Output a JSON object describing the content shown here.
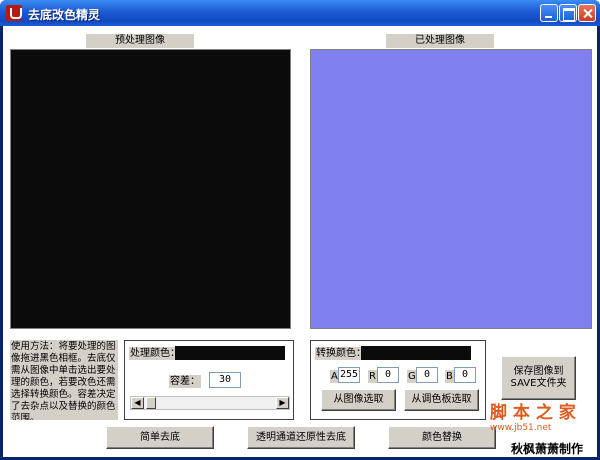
{
  "window": {
    "title": "去底改色精灵"
  },
  "panels": {
    "preview_label": "预处理图像",
    "processed_label": "已处理图像"
  },
  "instructions": "使用方法：将要处理的图像拖进黑色相框。去底仅需从图像中单击选出要处理的颜色，若要改色还需选择转换颜色。容差决定了去杂点以及替换的颜色范围。",
  "process_group": {
    "color_label": "处理颜色：",
    "tolerance_label": "容差：",
    "tolerance_value": "30"
  },
  "convert_group": {
    "color_label": "转换颜色：",
    "channels": [
      {
        "label": "A",
        "value": "255"
      },
      {
        "label": "R",
        "value": "0"
      },
      {
        "label": "G",
        "value": "0"
      },
      {
        "label": "B",
        "value": "0"
      }
    ],
    "pick_from_image": "从图像选取",
    "pick_from_palette": "从调色板选取"
  },
  "buttons": {
    "save": "保存图像到SAVE文件夹",
    "simple_remove": "简单去底",
    "transparent_restore": "透明通道还原性去底",
    "color_replace": "颜色替换"
  },
  "watermark": {
    "title": "脚 本 之 家",
    "url": "www.jb51.net"
  },
  "credit": "秋枫萧萧制作",
  "colors": {
    "preview_bg": "#0b0b0b",
    "processed_bg": "#7f7ff0",
    "process_color": "#0b0b0b",
    "convert_color": "#0b0b0b"
  }
}
